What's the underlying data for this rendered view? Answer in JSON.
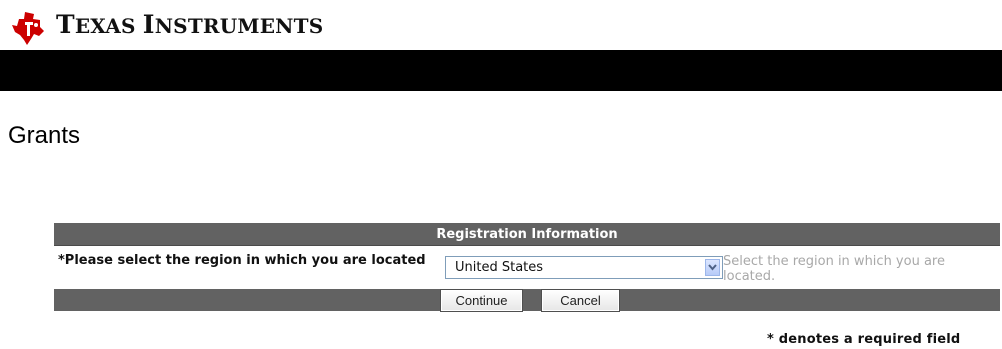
{
  "brand": {
    "logo_icon": "texas-instruments-logo-icon",
    "name_prefix_1": "T",
    "name_rest_1": "EXAS ",
    "name_prefix_2": "I",
    "name_rest_2": "NSTRUMENTS",
    "logo_color": "#cc0000"
  },
  "page": {
    "title": "Grants"
  },
  "form": {
    "header": "Registration Information",
    "region_label": "*Please select the region in which you are located",
    "region_value": "United States",
    "region_help": "Select the region in which you are located.",
    "continue_label": "Continue",
    "cancel_label": "Cancel"
  },
  "footer": {
    "required_note": "* denotes a required field"
  },
  "colors": {
    "header_bar": "#000000",
    "panel_gray": "#626262",
    "help_text": "#a8a8a8"
  }
}
